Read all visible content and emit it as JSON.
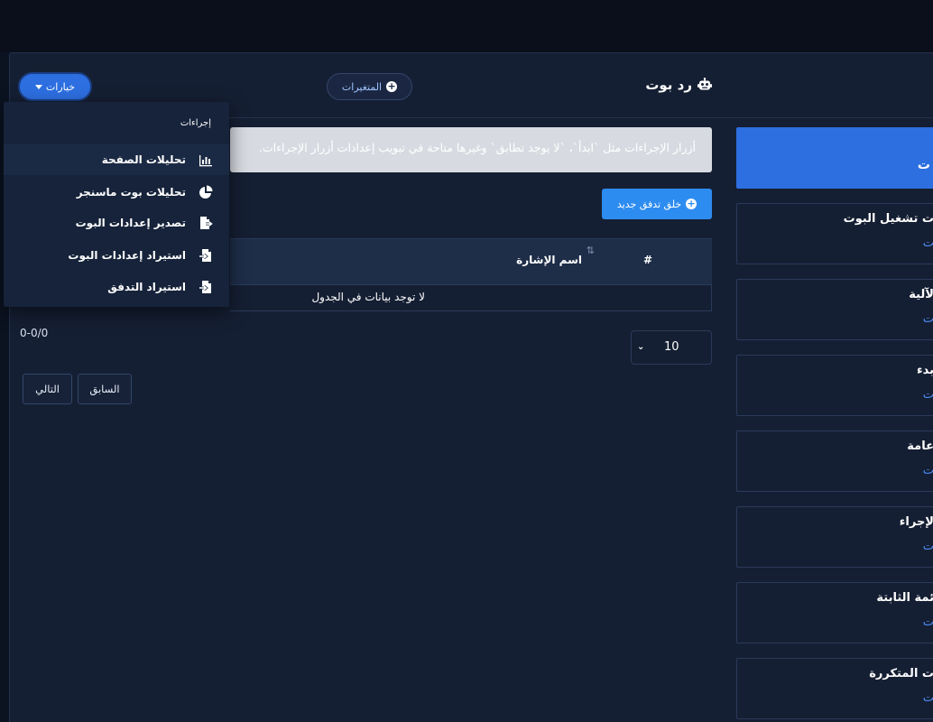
{
  "header": {
    "title": "رد بوت",
    "variables_label": "المتغيرات",
    "options_label": "خيارات"
  },
  "icons": {
    "title": "robot-icon",
    "variables": "plus-circle-icon",
    "options": "caret-down-icon"
  },
  "sidebar": {
    "active_title": "ت",
    "cards": [
      {
        "title": "ت تشغيل البوت",
        "subtitle": "ت"
      },
      {
        "title": "لآلية",
        "subtitle": "ت"
      },
      {
        "title": "بدء",
        "subtitle": "ت"
      },
      {
        "title": "عامة",
        "subtitle": "ت"
      },
      {
        "title": "لإجراء",
        "subtitle": "ت"
      },
      {
        "title": "ئمة الثابتة",
        "subtitle": "ت"
      },
      {
        "title": "ت المتكررة",
        "subtitle": "ت"
      }
    ]
  },
  "main": {
    "alert": "أزرار الإجراءات مثل `ابدأ`، `لا يوجد تطابق` وغيرها متاحة في تبويب إعدادات أزرار الإجراءات.",
    "create_label": "خلق تدفق جديد",
    "table": {
      "columns": [
        "#",
        "اسم الإشارة"
      ],
      "empty": "لا توجد بيانات في الجدول"
    },
    "page_size": "10",
    "count": "0-0/0",
    "prev_label": "السابق",
    "next_label": "التالي"
  },
  "dropdown": {
    "header": "إجراءات",
    "items": [
      {
        "label": "تحليلات الصفحة",
        "icon": "bar-chart-icon"
      },
      {
        "label": "تحليلات بوت ماسنجر",
        "icon": "pie-chart-icon"
      },
      {
        "label": "تصدير إعدادات البوت",
        "icon": "file-export-icon"
      },
      {
        "label": "استيراد إعدادات البوت",
        "icon": "file-import-icon"
      },
      {
        "label": "استيراد التدفق",
        "icon": "file-import-icon"
      }
    ]
  },
  "colors": {
    "accent": "#2d6fe0",
    "button": "#2d8cf0",
    "panel": "#151f33",
    "link": "#4b8bf5"
  }
}
